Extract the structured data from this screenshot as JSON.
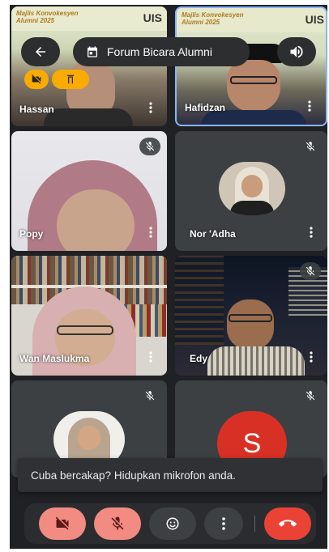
{
  "header": {
    "meeting_title": "Forum Bicara Alumni"
  },
  "banner": {
    "event_text": "Majlis Konvokesyen Alumni 2025",
    "brand_text": "UIS"
  },
  "participants": [
    {
      "name": "Hassan",
      "muted": false
    },
    {
      "name": "Hafidzan",
      "muted": false
    },
    {
      "name": "Popy",
      "muted": true
    },
    {
      "name": "Nor 'Adha",
      "muted": true
    },
    {
      "name": "Wan Maslukma",
      "muted": false
    },
    {
      "name": "Edy",
      "muted": true
    },
    {
      "name": "",
      "muted": true
    },
    {
      "name": "",
      "muted": true,
      "avatar_letter": "S"
    }
  ],
  "snackbar": {
    "message": "Cuba bercakap? Hidupkan mikrofon anda."
  },
  "colors": {
    "background": "#202124",
    "tile": "#3c4043",
    "active_border": "#8ab4f8",
    "camera_off": "#f28b82",
    "end_call": "#ea4335",
    "chip_yellow": "#f9ab00",
    "avatar_s": "#d93025"
  },
  "icons": {
    "back": "arrow-left-icon",
    "meeting": "calendar-icon",
    "audio": "speaker-icon",
    "more": "more-vert-icon",
    "muted": "mic-off-icon",
    "camera_off": "videocam-off-icon",
    "emoji": "emoji-icon",
    "end_call": "call-end-icon"
  }
}
